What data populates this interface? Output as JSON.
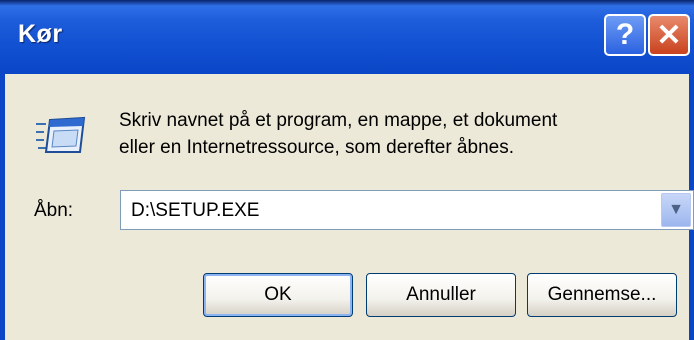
{
  "window": {
    "title": "Kør",
    "help_label": "?",
    "close_label": "✕"
  },
  "main": {
    "description_line1": "Skriv navnet på et program, en mappe, et dokument",
    "description_line2": "eller en Internetressource, som derefter åbnes.",
    "open_label": "Åbn:",
    "open_value": "D:\\SETUP.EXE",
    "dropdown_arrow": "▼"
  },
  "buttons": {
    "ok": "OK",
    "cancel": "Annuller",
    "browse": "Gennemse..."
  }
}
